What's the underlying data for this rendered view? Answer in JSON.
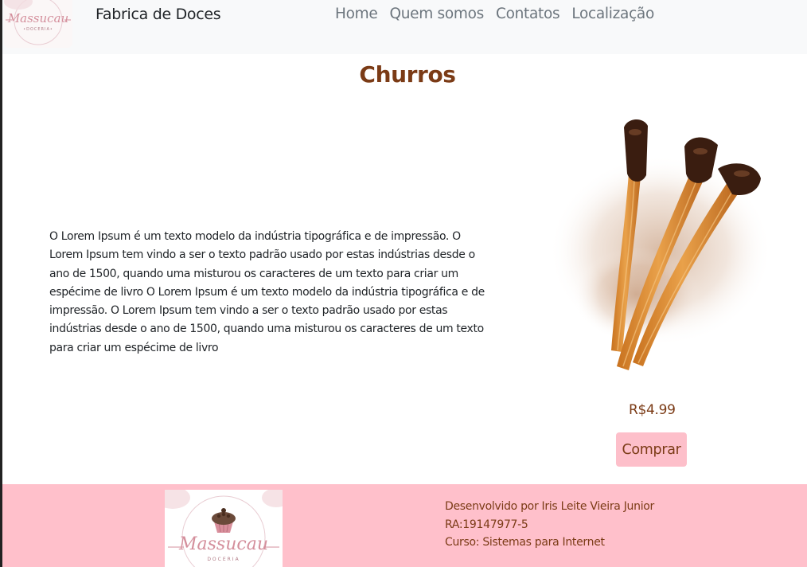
{
  "navbar": {
    "logo_alt": "Massucau Doceria",
    "brand": "Fabrica de Doces",
    "links": [
      {
        "label": "Home"
      },
      {
        "label": "Quem somos"
      },
      {
        "label": "Contatos"
      },
      {
        "label": "Localização"
      }
    ]
  },
  "product": {
    "title": "Churros",
    "description": "O Lorem Ipsum é um texto modelo da indústria tipográfica e de impressão. O Lorem Ipsum tem vindo a ser o texto padrão usado por estas indústrias desde o ano de 1500, quando uma misturou os caracteres de um texto para criar um espécime de livro O Lorem Ipsum é um texto modelo da indústria tipográfica e de impressão. O Lorem Ipsum tem vindo a ser o texto padrão usado por estas indústrias desde o ano de 1500, quando uma misturou os caracteres de um texto para criar um espécime de livro",
    "image_subject": "churros with chocolate and cinnamon sugar",
    "price": "R$4.99",
    "buy_label": "Comprar"
  },
  "footer": {
    "logo_text": "Massucau",
    "logo_subtext": "DOCERIA",
    "developer": "Desenvolvido por Iris Leite Vieira Junior",
    "ra": "RA:19147977-5",
    "course": "Curso: Sistemas para Internet"
  },
  "colors": {
    "accent_brown": "#7b3b16",
    "footer_pink": "#ffc0cb",
    "button_pink": "#fdbfca",
    "navbar_bg": "#f8f9fa"
  }
}
